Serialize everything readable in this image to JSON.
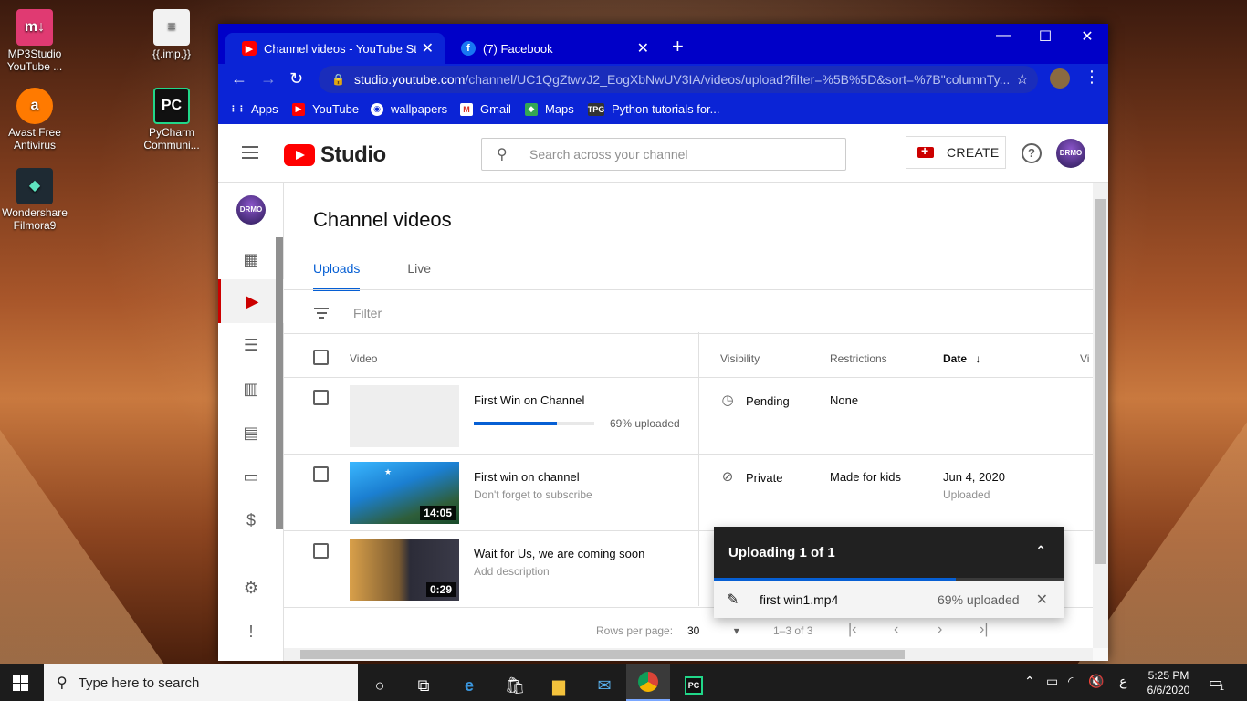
{
  "desktop": {
    "icons": [
      {
        "label": "MP3Studio YouTube ...",
        "glyph": "m↓"
      },
      {
        "label": "{{.imp.}}",
        "glyph": "≡"
      },
      {
        "label": "Avast Free Antivirus",
        "glyph": "a"
      },
      {
        "label": "PyCharm Communi...",
        "glyph": "PC"
      },
      {
        "label": "Wondershare Filmora9",
        "glyph": "◆"
      }
    ]
  },
  "browser": {
    "tabs": [
      {
        "title": "Channel videos - YouTube Studio",
        "close": "✕"
      },
      {
        "title": "(7) Facebook",
        "close": "✕"
      }
    ],
    "new_tab": "+",
    "window_controls": {
      "minimize": "—",
      "maximize": "☐",
      "close": "✕"
    },
    "url_host": "studio.youtube.com",
    "url_path": "/channel/UC1QgZtwvJ2_EogXbNwUV3IA/videos/upload?filter=%5B%5D&sort=%7B\"columnTy...",
    "bookmarks": [
      "Apps",
      "YouTube",
      "wallpapers",
      "Gmail",
      "Maps",
      "Python tutorials for..."
    ]
  },
  "studio": {
    "logo_text": "Studio",
    "search_placeholder": "Search across your channel",
    "create_label": "CREATE",
    "help_glyph": "?",
    "avatar_text": "DRMO",
    "page_title": "Channel videos",
    "tabs": [
      "Uploads",
      "Live"
    ],
    "filter_placeholder": "Filter",
    "columns": {
      "video": "Video",
      "visibility": "Visibility",
      "restrictions": "Restrictions",
      "date": "Date",
      "views": "Vi"
    },
    "rows": [
      {
        "title": "First Win on Channel",
        "description": "",
        "duration": "",
        "progress_text": "69% uploaded",
        "progress": 0.69,
        "visibility": "Pending",
        "visibility_icon": "clock-icon",
        "restrictions": "None",
        "date": "",
        "date_sub": ""
      },
      {
        "title": "First win on channel",
        "description": "Don't forget to subscribe",
        "duration": "14:05",
        "visibility": "Private",
        "visibility_icon": "eye-off-icon",
        "restrictions": "Made for kids",
        "date": "Jun 4, 2020",
        "date_sub": "Uploaded"
      },
      {
        "title": "Wait for Us, we are coming soon",
        "description": "Add description",
        "duration": "0:29",
        "visibility": "",
        "restrictions": "",
        "date": "",
        "date_sub": ""
      }
    ],
    "footer": {
      "rows_per_page_label": "Rows per page:",
      "rows_per_page_value": "30",
      "range": "1–3 of 3"
    },
    "upload_panel": {
      "title": "Uploading 1 of 1",
      "file": "first win1.mp4",
      "progress_text": "69% uploaded",
      "progress": 0.69
    }
  },
  "taskbar": {
    "search_placeholder": "Type here to search",
    "time": "5:25 PM",
    "date": "6/6/2020",
    "lang": "ع",
    "notifications": "1"
  },
  "colors": {
    "accent": "#065fd4",
    "brand_red": "#ff0000",
    "chrome_blue": "#0b24d6"
  }
}
